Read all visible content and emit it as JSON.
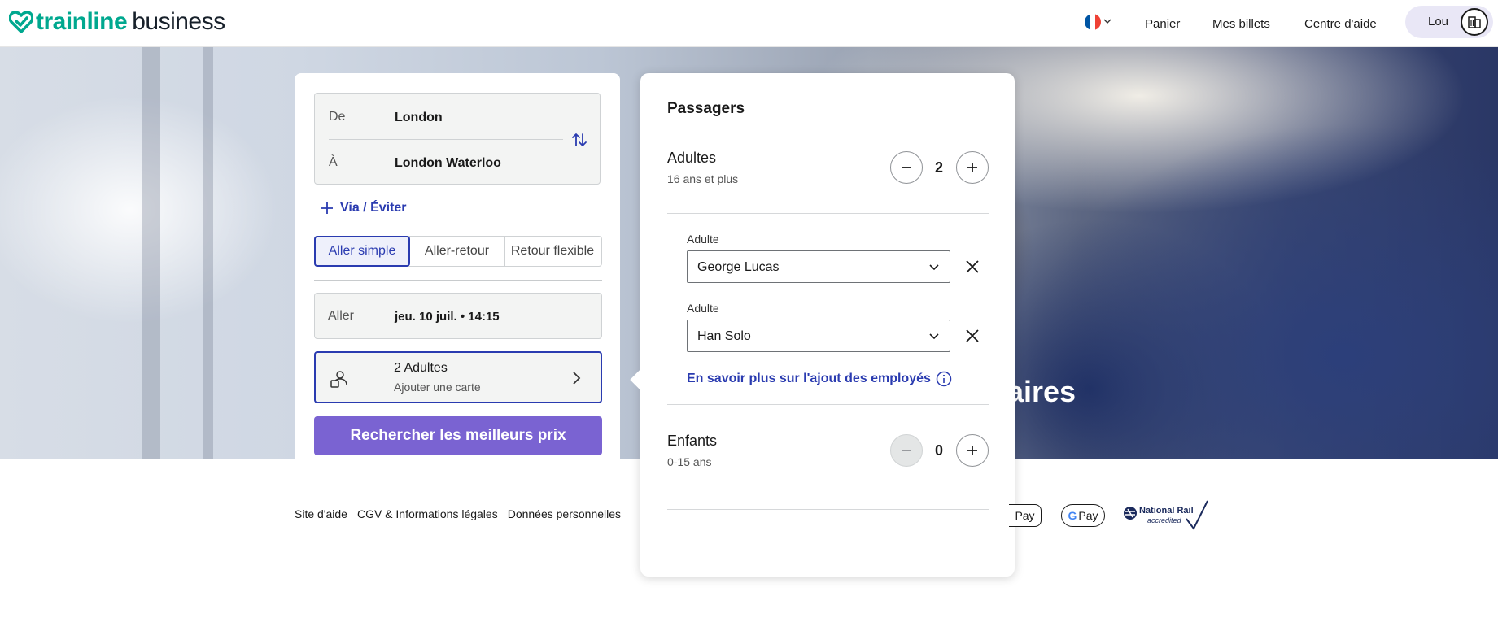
{
  "header": {
    "brand_main": "trainline",
    "brand_sub": "business",
    "nav": {
      "cart": "Panier",
      "tickets": "Mes billets",
      "help": "Centre d'aide"
    },
    "user": {
      "name": "Lou"
    },
    "flag_colors": [
      "#0055a4",
      "#ffffff",
      "#ef4135"
    ]
  },
  "hero": {
    "title_fragment": "aires"
  },
  "search": {
    "from_label": "De",
    "from_value": "London",
    "to_label": "À",
    "to_value": "London Waterloo",
    "via_label": "Via / Éviter",
    "trip_types": [
      "Aller simple",
      "Aller-retour",
      "Retour flexible"
    ],
    "trip_type_selected": "Aller simple",
    "outbound_label": "Aller",
    "outbound_value": "jeu. 10 juil. • 14:15",
    "passengers_summary": "2 Adultes",
    "passengers_sub": "Ajouter une carte",
    "search_button": "Rechercher les meilleurs prix"
  },
  "passengers_popup": {
    "title": "Passagers",
    "adults": {
      "label": "Adultes",
      "sub": "16 ans et plus",
      "count": "2"
    },
    "travellers": [
      {
        "label": "Adulte",
        "value": "George Lucas"
      },
      {
        "label": "Adulte",
        "value": "Han Solo"
      }
    ],
    "learn_more": "En savoir plus sur l'ajout des employés",
    "children": {
      "label": "Enfants",
      "sub": "0-15 ans",
      "count": "0"
    }
  },
  "footer": {
    "links": [
      "Site d'aide",
      "CGV & Informations légales",
      "Données personnelles"
    ],
    "apple_pay": "Pay",
    "google_pay": "Pay",
    "national_rail": "National Rail",
    "national_rail_sub": "accredited"
  },
  "colors": {
    "brand_green": "#00a88f",
    "accent_blue": "#2a3bb0",
    "button_purple": "#7a63d2"
  }
}
